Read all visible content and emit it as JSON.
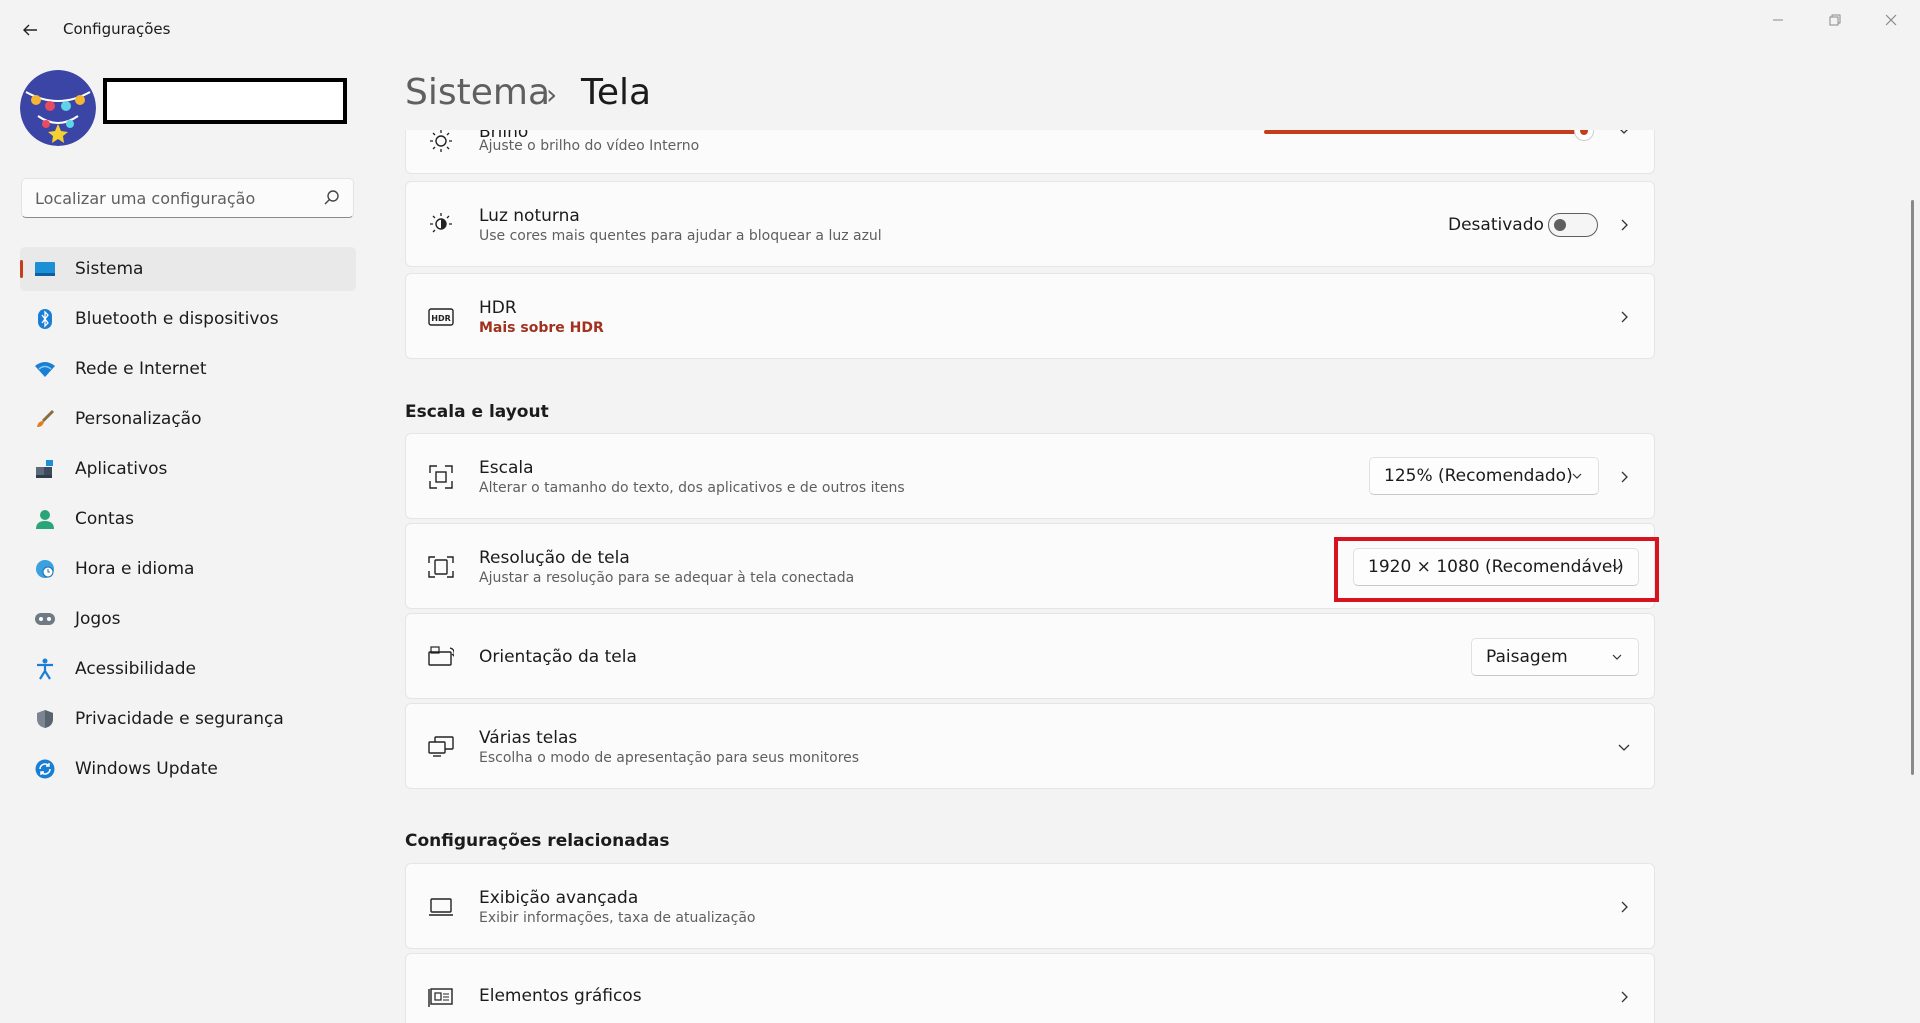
{
  "window": {
    "title": "Configurações",
    "controls": [
      "minimize-icon",
      "restore-icon",
      "close-icon"
    ]
  },
  "search": {
    "placeholder": "Localizar uma configuração"
  },
  "sidebar": {
    "items": [
      {
        "label": "Sistema",
        "icon": "system-monitor-icon",
        "active": true
      },
      {
        "label": "Bluetooth e dispositivos",
        "icon": "bluetooth-icon"
      },
      {
        "label": "Rede e Internet",
        "icon": "wifi-icon"
      },
      {
        "label": "Personalização",
        "icon": "paintbrush-icon"
      },
      {
        "label": "Aplicativos",
        "icon": "apps-icon"
      },
      {
        "label": "Contas",
        "icon": "account-icon"
      },
      {
        "label": "Hora e idioma",
        "icon": "clock-globe-icon"
      },
      {
        "label": "Jogos",
        "icon": "gamepad-icon"
      },
      {
        "label": "Acessibilidade",
        "icon": "accessibility-icon"
      },
      {
        "label": "Privacidade e segurança",
        "icon": "shield-icon"
      },
      {
        "label": "Windows Update",
        "icon": "update-icon"
      }
    ]
  },
  "breadcrumb": {
    "parent": "Sistema",
    "separator": "›",
    "current": "Tela"
  },
  "brightness": {
    "title": "Brilho",
    "subtitle": "Ajuste o brilho do vídeo Interno",
    "level": 0.98
  },
  "night_light": {
    "title": "Luz noturna",
    "subtitle": "Use cores mais quentes para ajudar a bloquear a luz azul",
    "status": "Desativado"
  },
  "hdr": {
    "title": "HDR",
    "link": "Mais sobre HDR"
  },
  "section_scale": {
    "title": "Escala e layout"
  },
  "scale": {
    "title": "Escala",
    "subtitle": "Alterar o tamanho do texto, dos aplicativos e de outros itens",
    "value": "125% (Recomendado)"
  },
  "resolution": {
    "title": "Resolução de tela",
    "subtitle": "Ajustar a resolução para se adequar à tela conectada",
    "value": "1920 × 1080 (Recomendável)"
  },
  "orientation": {
    "title": "Orientação da tela",
    "value": "Paisagem"
  },
  "multiple_displays": {
    "title": "Várias telas",
    "subtitle": "Escolha o modo de apresentação para seus monitores"
  },
  "section_related": {
    "title": "Configurações relacionadas"
  },
  "advanced_display": {
    "title": "Exibição avançada",
    "subtitle": "Exibir informações, taxa de atualização"
  },
  "graphics": {
    "title": "Elementos gráficos"
  },
  "colors": {
    "accent": "#c43e1c",
    "highlight": "#d6131f",
    "link": "#a0321e"
  }
}
